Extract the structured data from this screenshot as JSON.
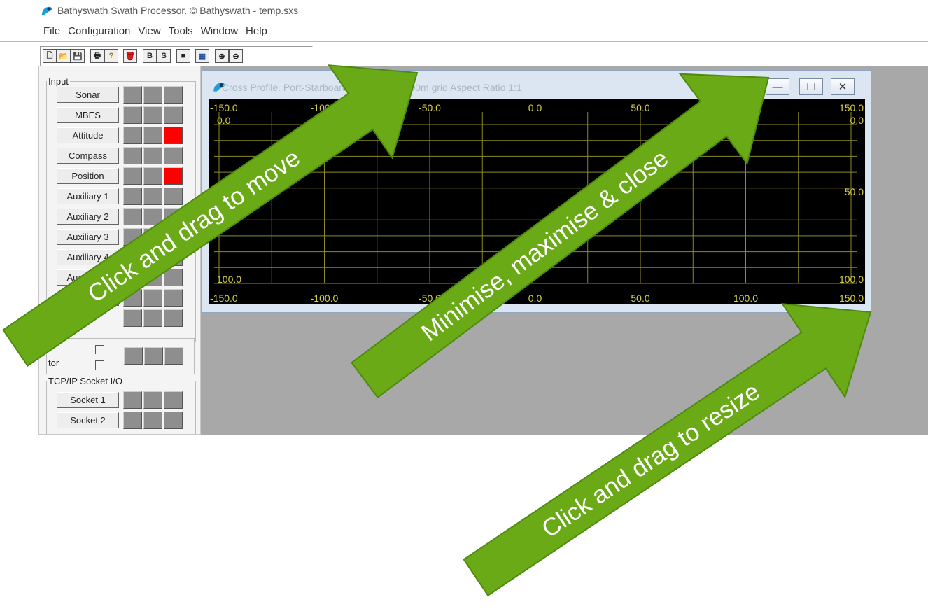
{
  "app": {
    "title": "Bathyswath Swath Processor.  © Bathyswath - temp.sxs"
  },
  "menu": [
    "File",
    "Configuration",
    "View",
    "Tools",
    "Window",
    "Help"
  ],
  "toolbar": {
    "buttons": [
      {
        "name": "new-icon",
        "glyph": "🗋"
      },
      {
        "name": "open-folder-icon",
        "glyph": "📂"
      },
      {
        "name": "save-icon",
        "glyph": "💾"
      },
      {
        "name": "print-icon",
        "glyph": "🖶"
      },
      {
        "name": "help-icon",
        "glyph": "?"
      },
      {
        "name": "trash-icon",
        "glyph": "🗑"
      },
      {
        "name": "b-icon",
        "glyph": "B"
      },
      {
        "name": "s-icon",
        "glyph": "S"
      },
      {
        "name": "display-icon",
        "glyph": "■"
      },
      {
        "name": "color-grid-icon",
        "glyph": "▦"
      },
      {
        "name": "zoom-in-icon",
        "glyph": "⊕"
      },
      {
        "name": "zoom-out-icon",
        "glyph": "⊖"
      }
    ]
  },
  "input_panel": {
    "legend": "Input",
    "items": [
      {
        "label": "Sonar",
        "status": [
          "off",
          "off",
          "off"
        ]
      },
      {
        "label": "MBES",
        "status": [
          "off",
          "off",
          "off"
        ]
      },
      {
        "label": "Attitude",
        "status": [
          "off",
          "off",
          "red"
        ]
      },
      {
        "label": "Compass",
        "status": [
          "off",
          "off",
          "off"
        ]
      },
      {
        "label": "Position",
        "status": [
          "off",
          "off",
          "red"
        ]
      },
      {
        "label": "Auxiliary 1",
        "status": [
          "off",
          "off",
          "off"
        ]
      },
      {
        "label": "Auxiliary 2",
        "status": [
          "off",
          "off",
          "off"
        ]
      },
      {
        "label": "Auxiliary 3",
        "status": [
          "off",
          "off",
          "off"
        ]
      },
      {
        "label": "Auxiliary 4",
        "status": [
          "off",
          "off",
          "off"
        ]
      },
      {
        "label": "Auxiliary 5",
        "status": [
          "off",
          "off",
          "off"
        ]
      },
      {
        "label": "Auxiliary 6",
        "status": [
          "off",
          "off",
          "off"
        ]
      },
      {
        "label": "",
        "status": [
          "off",
          "off",
          "off"
        ]
      }
    ],
    "partial_label": "tor",
    "colors": {
      "indicator_off": "#8e8e8e",
      "indicator_on": "#ff0000"
    }
  },
  "socket_panel": {
    "legend": "TCP/IP Socket I/O",
    "items": [
      {
        "label": "Socket 1"
      },
      {
        "label": "Socket 2"
      }
    ]
  },
  "cross_profile": {
    "title": "Cross Profile. Port-Starboard, 25.00m x 10.00m grid Aspect Ratio 1:1",
    "top_x_labels": [
      "-150.0",
      "-100.0",
      "-50.0",
      "0.0",
      "50.0",
      "150.0"
    ],
    "bottom_x_labels": [
      "-150.0",
      "-100.0",
      "-50.0",
      "0.0",
      "50.0",
      "100.0",
      "150.0"
    ],
    "left_y_labels": [
      "0.0",
      "100.0"
    ],
    "right_y_labels": [
      "0.0",
      "50.0",
      "100.0"
    ],
    "colors": {
      "background": "#000000",
      "grid": "#8c8a23",
      "labels": "#d7cf4a"
    }
  },
  "window_controls": {
    "minimise": "—",
    "maximise": "☐",
    "close": "✕"
  },
  "callouts": [
    {
      "text": "Click and drag to move"
    },
    {
      "text": "Minimise, maximise & close"
    },
    {
      "text": "Click and drag to resize"
    }
  ],
  "colors": {
    "callout_fill": "#6aaa17",
    "callout_border": "#4e8a0e",
    "mdi_background": "#a8a8a8"
  }
}
